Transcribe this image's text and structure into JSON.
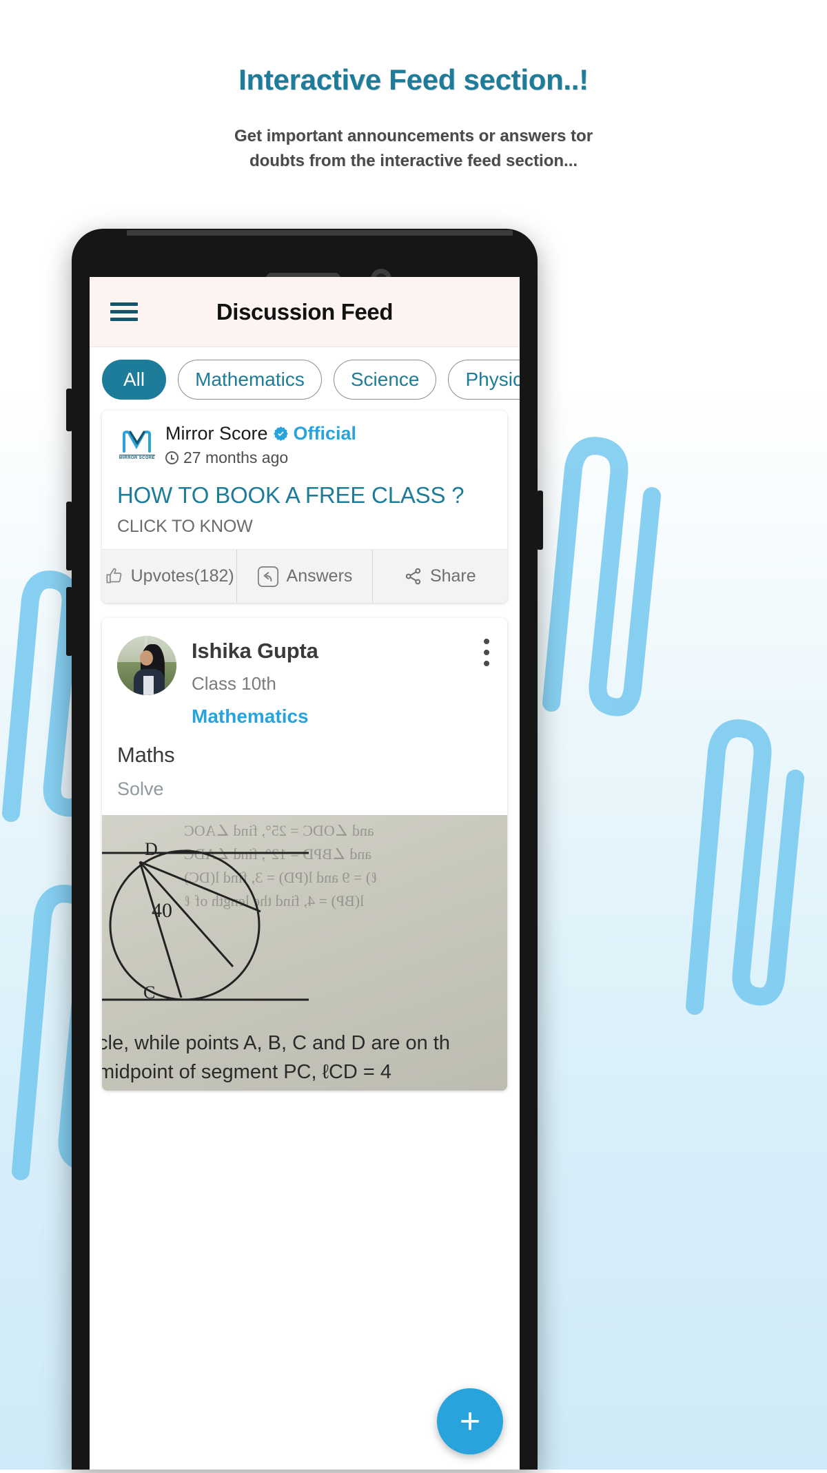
{
  "promo": {
    "title": "Interactive Feed section..!",
    "subtitle_line1": "Get important announcements or answers tor",
    "subtitle_line2": "doubts from the interactive feed section...",
    "title_color": "#1d7c99",
    "subtitle_color": "#4a4a4a"
  },
  "appbar": {
    "title": "Discussion Feed",
    "menu_icon": "hamburger-icon",
    "background": "#fdf4f2"
  },
  "filters": {
    "chips": [
      {
        "label": "All",
        "active": true
      },
      {
        "label": "Mathematics",
        "active": false
      },
      {
        "label": "Science",
        "active": false
      },
      {
        "label": "Physics",
        "active": false
      }
    ],
    "accent": "#1d7c99"
  },
  "official_post": {
    "logo_text": "MIRROR SCORE",
    "author": "Mirror Score",
    "verified_icon": "verified-badge-icon",
    "badge_label": "Official",
    "badge_color": "#29a3dc",
    "time_icon": "clock-icon",
    "time": "27 months ago",
    "headline": "HOW TO BOOK A FREE CLASS ?",
    "subtext": "CLICK TO KNOW",
    "actions": [
      {
        "icon": "thumbs-up-icon",
        "label": "Upvotes(182)"
      },
      {
        "icon": "reply-arrow-icon",
        "label": "Answers"
      },
      {
        "icon": "share-icon",
        "label": "Share"
      }
    ]
  },
  "question_post": {
    "avatar_icon": "user-avatar",
    "name": "Ishika Gupta",
    "class": "Class 10th",
    "subject": "Mathematics",
    "subject_color": "#29a3dc",
    "menu_icon": "kebab-menu-icon",
    "title": "Maths",
    "body": "Solve",
    "attachment": {
      "type": "handwritten-worksheet-image",
      "label_d": "D",
      "label_c": "C",
      "angle": "40",
      "ghost_line1": "and ∠ODC = 25°, find ∠AOC",
      "ghost_line2": "and ∠BPD = 12°, find ∠ADC",
      "ghost_line3": "ℓ) = 9 and l(PD) = 3, find l(DC)",
      "ghost_line4": "l(BP) = 4, find the length of ℓ",
      "text_line1": "cle, while points A, B, C and D are on th",
      "text_line2": "midpoint of segment PC, ℓCD = 4"
    }
  },
  "fab": {
    "icon": "plus-icon",
    "label": "+",
    "color": "#29a3dc"
  }
}
